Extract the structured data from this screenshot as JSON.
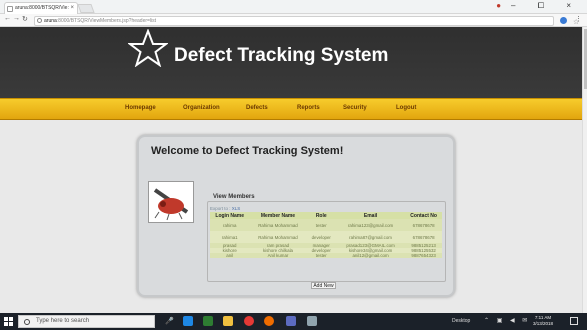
{
  "browser": {
    "tab_title": "aruna:8000/BTSQR/Vie:",
    "address_host": "aruna",
    "address_path": ":8000/BTSQR/ViewMembers.jsp?header=list",
    "window_controls": "– ⧠ ×"
  },
  "site": {
    "title": "Defect Tracking System",
    "nav": {
      "homepage": "Homepage",
      "organization": "Organization",
      "defects": "Defects",
      "reports": "Reports",
      "security": "Security",
      "logout": "Logout"
    }
  },
  "content": {
    "welcome": "Welcome to Defect Tracking System!",
    "legend": "View Members",
    "export_prefix": "Export to : ",
    "export_xls": "XLS",
    "add_new": "Add New",
    "table": {
      "headers": [
        "Login Name",
        "Member Name",
        "Role",
        "Email",
        "Contact No"
      ],
      "rows": [
        [
          "rahima",
          "Rahima Mohammad",
          "tester",
          "rahima123@gmail.com",
          "678678678"
        ],
        [
          "rahima1",
          "Rahima Mohammad",
          "developer",
          "rahima87@gmail.com",
          "678678678"
        ],
        [
          "prasad",
          "ram prasad",
          "manager",
          "prasad123@GMAIL.com",
          "9885125213"
        ],
        [
          "kishore",
          "kishore chilkala",
          "developer",
          "kishore34@gmail.com",
          "9885125532"
        ],
        [
          "anil",
          "Anil kumar",
          "tester",
          "anil12@gmail.com",
          "9887654323"
        ]
      ]
    }
  },
  "taskbar": {
    "search_placeholder": "Type here to search",
    "desktop_label": "Desktop",
    "time": "7:11 AM",
    "date": "3/13/2018"
  },
  "colors": {
    "header_bg": "#333333",
    "nav_gold": "#f0b81c",
    "table_header": "#d6e0a6",
    "taskbar": "#1b2129"
  }
}
